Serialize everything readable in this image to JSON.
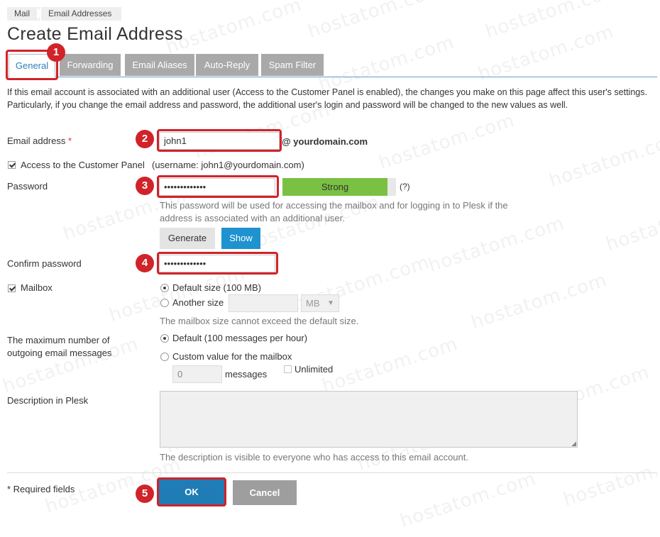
{
  "breadcrumb": {
    "items": [
      "Mail",
      "Email Addresses"
    ]
  },
  "page_title": "Create Email Address",
  "tabs": [
    {
      "label": "General",
      "active": true
    },
    {
      "label": "Forwarding"
    },
    {
      "label": "Email Aliases"
    },
    {
      "label": "Auto-Reply"
    },
    {
      "label": "Spam Filter"
    }
  ],
  "intro_text": "If this email account is associated with an additional user (Access to the Customer Panel is enabled), the changes you make on this page affect this user's settings. Particularly, if you change the email address and password, the additional user's login and password will be changed to the new values as well.",
  "email": {
    "label": "Email address",
    "required_mark": "*",
    "value": "john1",
    "domain": "@ yourdomain.com"
  },
  "customer_panel": {
    "checked": true,
    "label": "Access to the Customer Panel",
    "username_note": "(username: john1@yourdomain.com)"
  },
  "password": {
    "label": "Password",
    "masked_value": "•••••••••••••",
    "strength_label": "Strong",
    "help_link": "(?)",
    "hint": "This password will be used for accessing the mailbox and for logging in to Plesk if the address is associated with an additional user.",
    "generate_label": "Generate",
    "show_label": "Show"
  },
  "confirm_password": {
    "label": "Confirm password",
    "masked_value": "•••••••••••••"
  },
  "mailbox": {
    "checked": true,
    "label": "Mailbox",
    "option_default": "Default size (100 MB)",
    "option_another": "Another size",
    "size_unit": "MB",
    "hint": "The mailbox size cannot exceed the default size."
  },
  "outgoing": {
    "label_line1": "The maximum number of",
    "label_line2": "outgoing email messages",
    "option_default": "Default (100 messages per hour)",
    "option_custom": "Custom value for the mailbox",
    "custom_value": "0",
    "messages_label": "messages",
    "unlimited_label": "Unlimited"
  },
  "description": {
    "label": "Description in Plesk",
    "value": "",
    "hint": "The description is visible to everyone who has access to this email account."
  },
  "footer": {
    "required_note": "* Required fields",
    "ok_label": "OK",
    "cancel_label": "Cancel"
  },
  "callouts": [
    "1",
    "2",
    "3",
    "4",
    "5"
  ],
  "watermark": "hostatom.com",
  "colors": {
    "callout_red": "#d0232a",
    "tab_active_text": "#2e7fb8",
    "strength_green": "#7ac043",
    "ok_blue": "#1f7cb5",
    "cancel_grey": "#9e9e9e"
  }
}
